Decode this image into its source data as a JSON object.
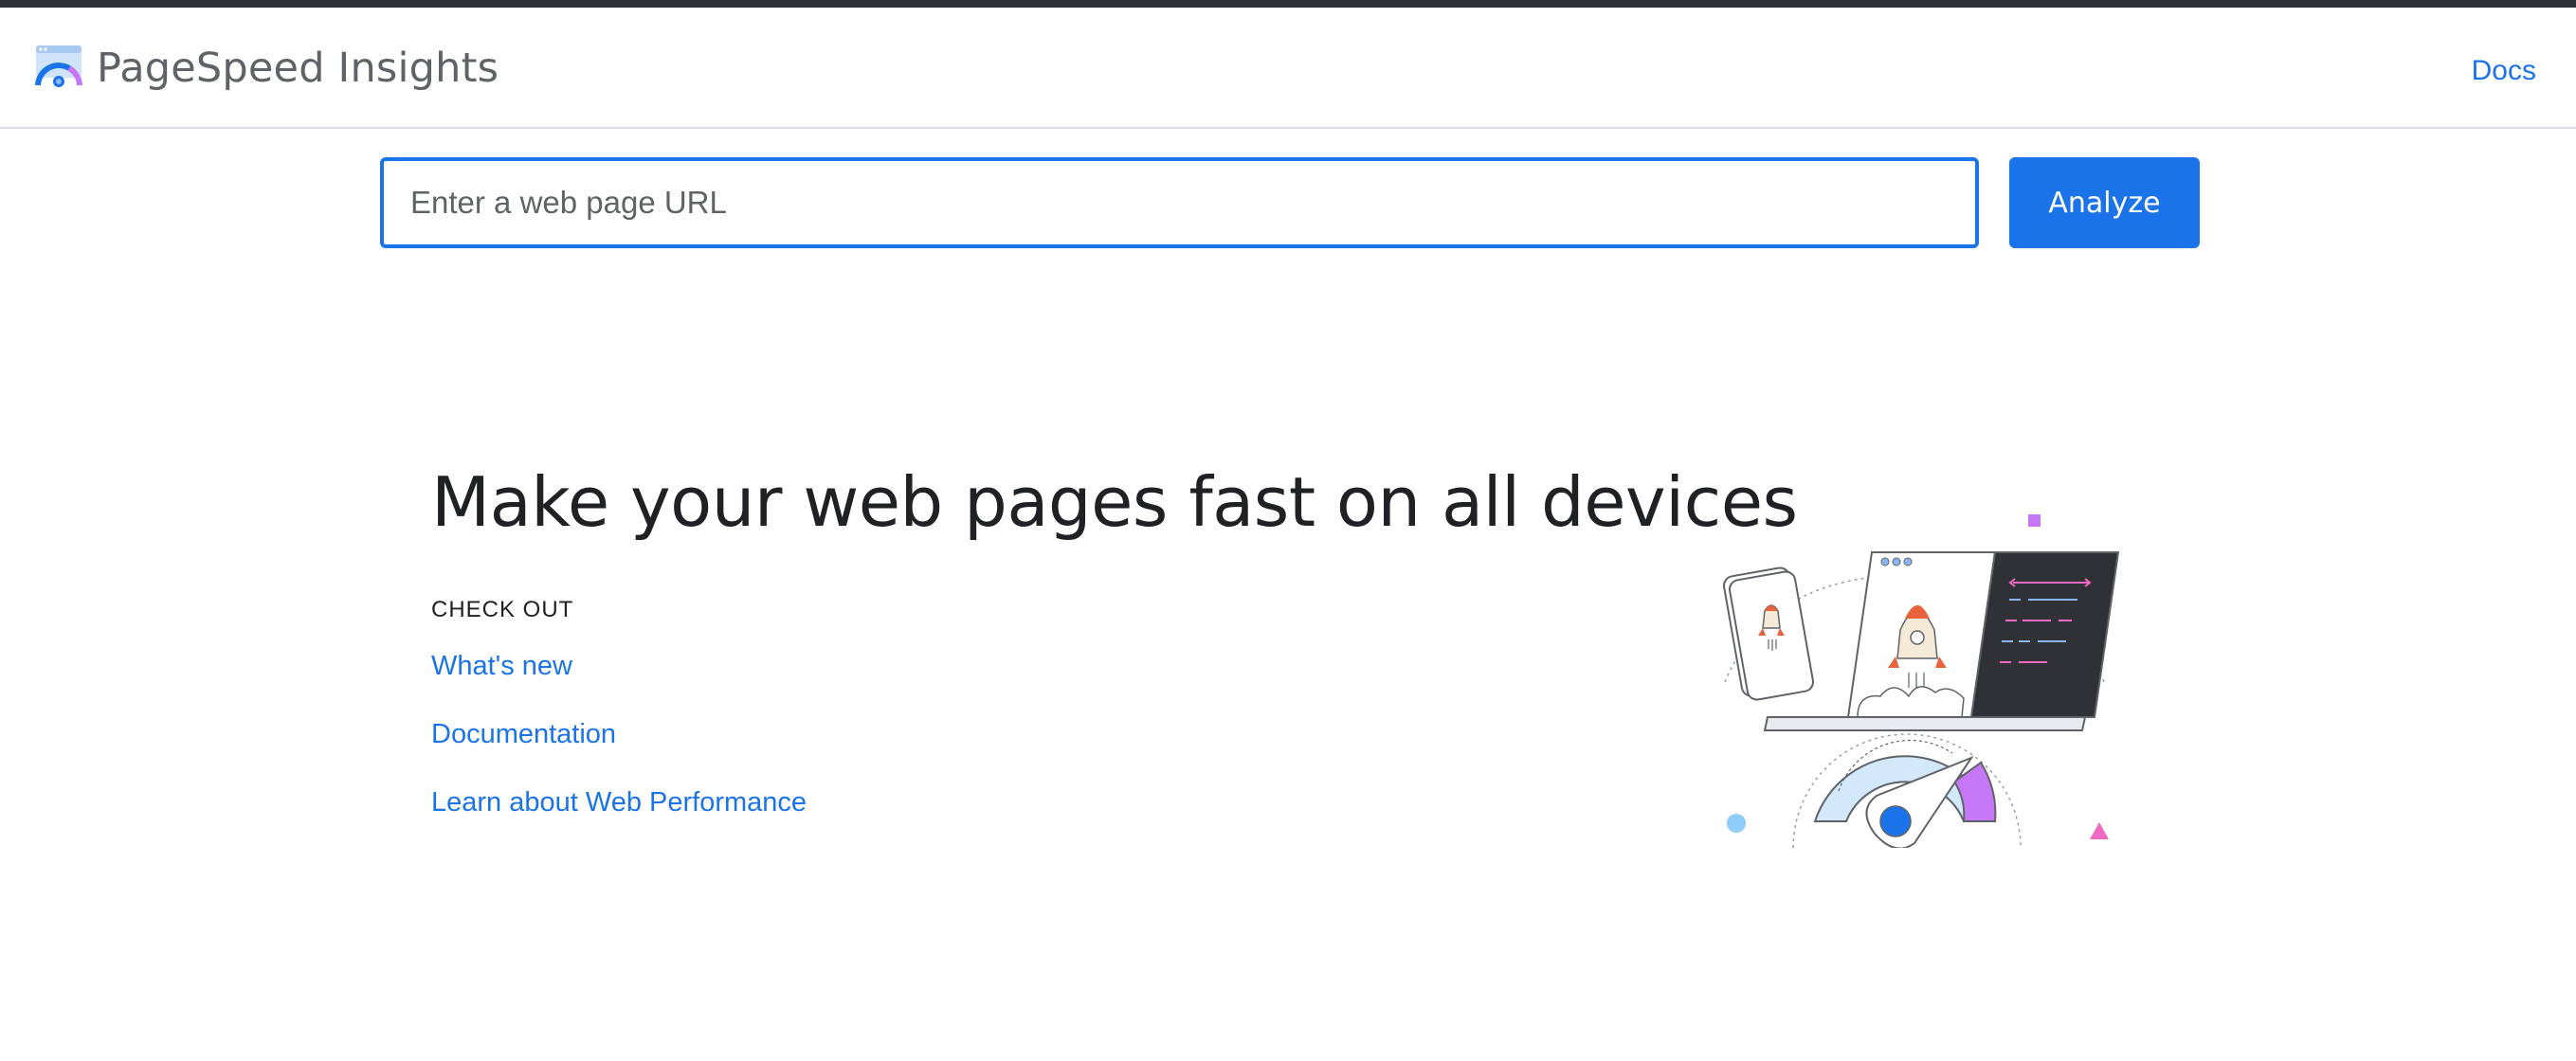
{
  "header": {
    "title": "PageSpeed Insights",
    "logo_icon": "pagespeed-gauge-icon",
    "docs_label": "Docs"
  },
  "search": {
    "placeholder": "Enter a web page URL",
    "value": "",
    "analyze_label": "Analyze"
  },
  "hero": {
    "title": "Make your web pages fast on all devices",
    "checkout_heading": "CHECK OUT",
    "links": [
      {
        "label": "What's new"
      },
      {
        "label": "Documentation"
      },
      {
        "label": "Learn about Web Performance"
      }
    ]
  },
  "colors": {
    "accent": "#1a73e8",
    "top_strip": "#303134",
    "title_text": "#202124",
    "muted_text": "#5f6368",
    "divider": "#dadce0",
    "gauge_purple": "#c577f5",
    "gauge_light_blue": "#d2e9fb",
    "shape_pink": "#f06ac4"
  }
}
